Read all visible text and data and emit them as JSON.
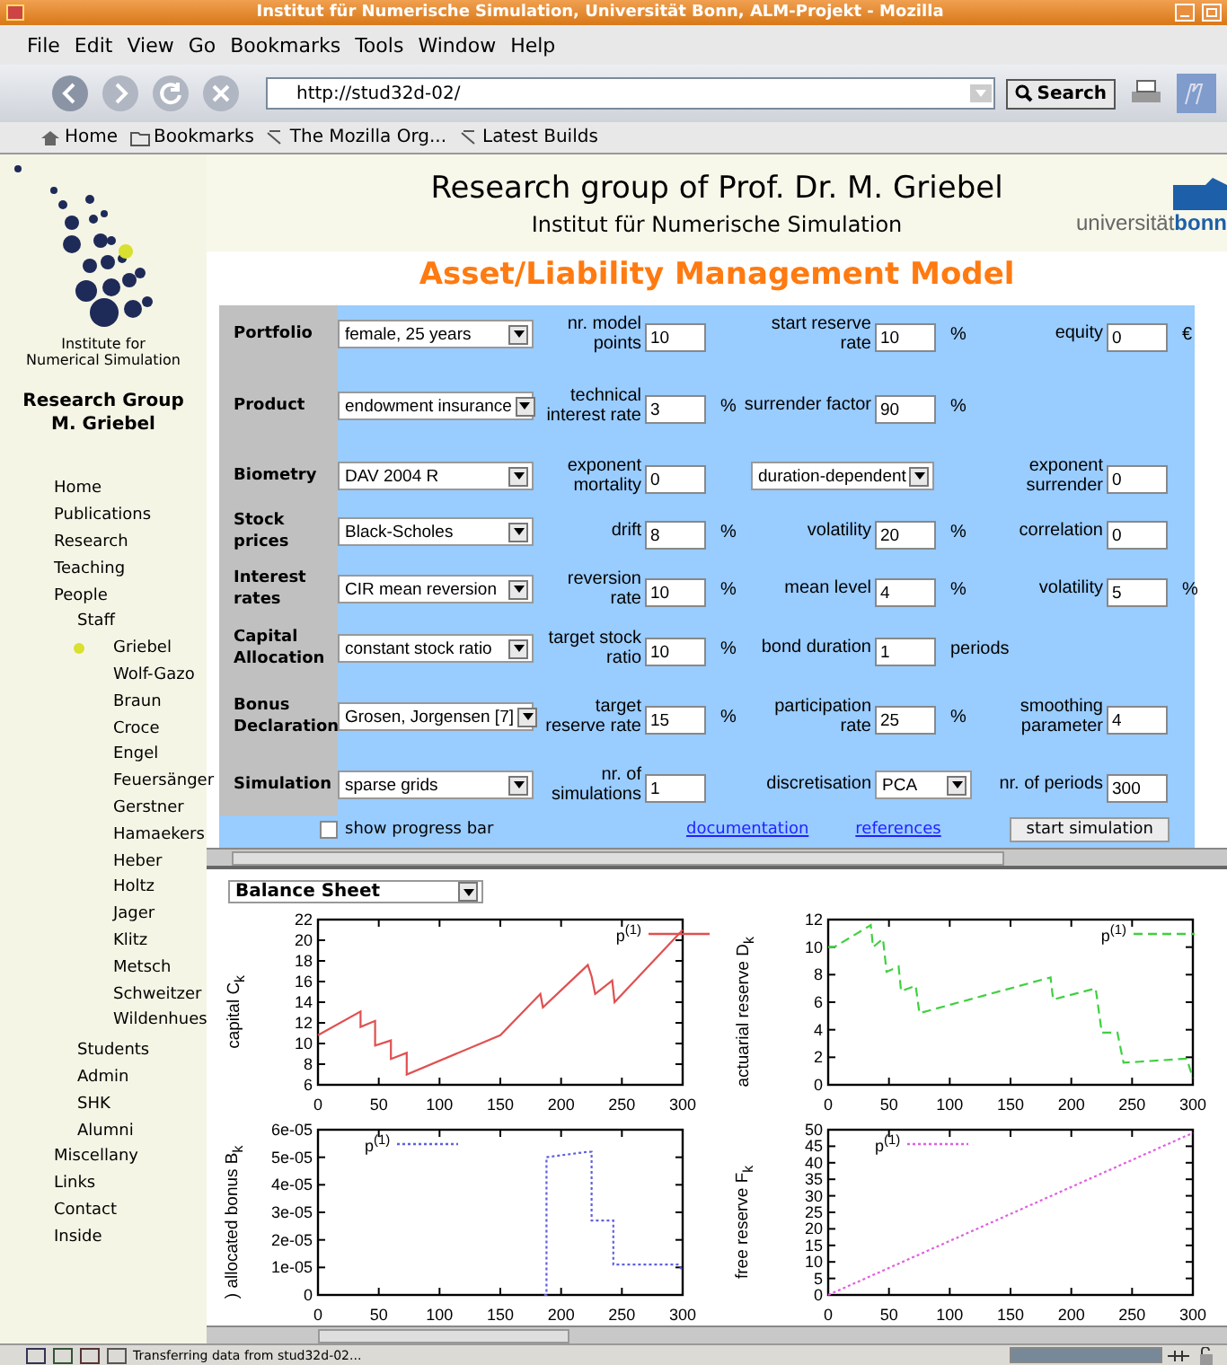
{
  "window": {
    "title": "Institut für Numerische Simulation, Universität Bonn, ALM-Projekt - Mozilla"
  },
  "menu": [
    "File",
    "Edit",
    "View",
    "Go",
    "Bookmarks",
    "Tools",
    "Window",
    "Help"
  ],
  "toolbar": {
    "url": "http://stud32d-02/",
    "search_button": "Search"
  },
  "bookmarks": [
    {
      "label": "Home",
      "kind": "home"
    },
    {
      "label": "Bookmarks",
      "kind": "folder"
    },
    {
      "label": "The Mozilla Org...",
      "kind": "link"
    },
    {
      "label": "Latest Builds",
      "kind": "link"
    }
  ],
  "sidebar": {
    "institute": "Institute for Numerical Simulation",
    "group": "Research Group M. Griebel",
    "items": [
      {
        "label": "Home",
        "selected": false
      },
      {
        "label": "Publications",
        "selected": false
      },
      {
        "label": "Research",
        "selected": false
      },
      {
        "label": "Teaching",
        "selected": false
      },
      {
        "label": "People",
        "selected": false,
        "children": [
          {
            "label": "Staff",
            "selected": false,
            "children": [
              {
                "label": "Griebel",
                "selected": true
              },
              {
                "label": "Wolf-Gazo",
                "selected": false
              },
              {
                "label": "Braun",
                "selected": false
              },
              {
                "label": "Croce",
                "selected": false
              },
              {
                "label": "Engel",
                "selected": false
              },
              {
                "label": "Feuersänger",
                "selected": false
              },
              {
                "label": "Gerstner",
                "selected": false
              },
              {
                "label": "Hamaekers",
                "selected": false
              },
              {
                "label": "Heber",
                "selected": false
              },
              {
                "label": "Holtz",
                "selected": false
              },
              {
                "label": "Jager",
                "selected": false
              },
              {
                "label": "Klitz",
                "selected": false
              },
              {
                "label": "Metsch",
                "selected": false
              },
              {
                "label": "Schweitzer",
                "selected": false
              },
              {
                "label": "Wildenhues",
                "selected": false
              }
            ]
          },
          {
            "label": "Students",
            "selected": false
          },
          {
            "label": "Admin",
            "selected": false
          },
          {
            "label": "SHK",
            "selected": false
          },
          {
            "label": "Alumni",
            "selected": false
          }
        ]
      },
      {
        "label": "Miscellany",
        "selected": false
      },
      {
        "label": "Links",
        "selected": false
      },
      {
        "label": "Contact",
        "selected": false
      },
      {
        "label": "Inside",
        "selected": false
      }
    ]
  },
  "header": {
    "title": "Research group of Prof. Dr. M. Griebel",
    "subtitle": "Institut für Numerische Simulation",
    "logo_prefix": "universität",
    "logo_name": "bonn"
  },
  "page_title": "Asset/Liability Management Model",
  "form": {
    "rows": [
      {
        "label": "Portfolio",
        "select": "female, 25 years",
        "fields": [
          {
            "kind": "input",
            "label": "nr. model points",
            "value": "10"
          },
          {
            "kind": "input",
            "label": "start reserve rate",
            "value": "10",
            "unit": "%"
          },
          {
            "kind": "input",
            "label": "equity",
            "value": "0",
            "unit": "€"
          }
        ]
      },
      {
        "label": "Product",
        "select": "endowment insurance",
        "fields": [
          {
            "kind": "input",
            "label": "technical interest rate",
            "value": "3",
            "unit": "%"
          },
          {
            "kind": "input",
            "label": "surrender factor",
            "value": "90",
            "unit": "%"
          }
        ]
      },
      {
        "label": "Biometry",
        "select": "DAV 2004 R",
        "fields": [
          {
            "kind": "input",
            "label": "exponent mortality",
            "value": "0"
          },
          {
            "kind": "select",
            "value": "duration-dependent"
          },
          {
            "kind": "input",
            "label": "exponent surrender",
            "value": "0"
          }
        ]
      },
      {
        "label": "Stock prices",
        "select": "Black-Scholes",
        "fields": [
          {
            "kind": "input",
            "label": "drift",
            "value": "8",
            "unit": "%"
          },
          {
            "kind": "input",
            "label": "volatility",
            "value": "20",
            "unit": "%"
          },
          {
            "kind": "input",
            "label": "correlation",
            "value": "0"
          }
        ]
      },
      {
        "label": "Interest rates",
        "select": "CIR mean reversion",
        "fields": [
          {
            "kind": "input",
            "label": "reversion rate",
            "value": "10",
            "unit": "%"
          },
          {
            "kind": "input",
            "label": "mean level",
            "value": "4",
            "unit": "%"
          },
          {
            "kind": "input",
            "label": "volatility",
            "value": "5",
            "unit": "%"
          }
        ]
      },
      {
        "label": "Capital Allocation",
        "select": "constant stock ratio",
        "fields": [
          {
            "kind": "input",
            "label": "target stock ratio",
            "value": "10",
            "unit": "%"
          },
          {
            "kind": "input",
            "label": "bond duration",
            "value": "1",
            "unit": "periods"
          }
        ]
      },
      {
        "label": "Bonus Declaration",
        "select": "Grosen, Jorgensen [7]",
        "fields": [
          {
            "kind": "input",
            "label": "target reserve rate",
            "value": "15",
            "unit": "%"
          },
          {
            "kind": "input",
            "label": "participation rate",
            "value": "25",
            "unit": "%"
          },
          {
            "kind": "input",
            "label": "smoothing parameter",
            "value": "4"
          }
        ]
      },
      {
        "label": "Simulation",
        "select": "sparse grids",
        "fields": [
          {
            "kind": "input",
            "label": "nr. of simulations",
            "value": "1"
          },
          {
            "kind": "select",
            "label": "discretisation",
            "value": "PCA"
          },
          {
            "kind": "input",
            "label": "nr. of periods",
            "value": "300"
          }
        ]
      }
    ],
    "progress": {
      "label": "show progress bar",
      "checked": false
    },
    "links": [
      "documentation",
      "references"
    ],
    "start_button": "start simulation"
  },
  "applet": {
    "view": "Balance Sheet",
    "charts": [
      {
        "chart_data": {
          "type": "line",
          "ylabel": "capital C$_{k}$",
          "xlim": [
            0,
            300
          ],
          "ylim": [
            6,
            22
          ],
          "xticks": [
            0,
            50,
            100,
            150,
            200,
            250,
            300
          ],
          "yticks": [
            6,
            8,
            10,
            12,
            14,
            16,
            18,
            20,
            22
          ],
          "x": [
            0,
            35,
            35,
            47,
            47,
            60,
            60,
            73,
            73,
            150,
            183,
            185,
            222,
            225,
            228,
            242,
            244,
            300
          ],
          "series": [
            {
              "name": "p$^{(1)}$",
              "color": "#e05050",
              "line_style": "solid",
              "values": [
                10.8,
                13.1,
                11.6,
                12.2,
                9.8,
                10.3,
                8.5,
                9.1,
                7.0,
                10.8,
                14.8,
                13.5,
                17.6,
                16.5,
                14.8,
                16.1,
                14.0,
                21
              ]
            }
          ]
        }
      },
      {
        "chart_data": {
          "type": "line",
          "ylabel": "actuarial reserve D$_{k}$",
          "xlim": [
            0,
            300
          ],
          "ylim": [
            0,
            12
          ],
          "xticks": [
            0,
            50,
            100,
            150,
            200,
            250,
            300
          ],
          "yticks": [
            0,
            2,
            4,
            6,
            8,
            10,
            12
          ],
          "x": [
            0,
            5,
            35,
            37,
            45,
            48,
            58,
            60,
            72,
            75,
            183,
            185,
            220,
            225,
            238,
            243,
            295,
            300
          ],
          "series": [
            {
              "name": "p$^{(1)}$",
              "color": "#40d040",
              "line_style": "dashed",
              "values": [
                10,
                10,
                11.6,
                10,
                10.6,
                8.2,
                8.6,
                6.8,
                7.2,
                5.2,
                7.8,
                6.2,
                7.0,
                3.8,
                3.8,
                1.6,
                1.9,
                0.5
              ]
            }
          ]
        }
      },
      {
        "chart_data": {
          "type": "line",
          "ylabel": ") allocated bonus B$_{k}$",
          "xlim": [
            0,
            300
          ],
          "ylim": [
            0,
            6e-05
          ],
          "xticks": [
            0,
            50,
            100,
            150,
            200,
            250,
            300
          ],
          "yticks": [
            {
              "value": 0,
              "label": "0"
            },
            {
              "value": 1e-05,
              "label": "1e-05"
            },
            {
              "value": 2e-05,
              "label": "2e-05"
            },
            {
              "value": 3e-05,
              "label": "3e-05"
            },
            {
              "value": 4e-05,
              "label": "4e-05"
            },
            {
              "value": 5e-05,
              "label": "5e-05"
            },
            {
              "value": 6e-05,
              "label": "6e-05"
            }
          ],
          "x": [
            186,
            188,
            188,
            222,
            225,
            225,
            241,
            243,
            243,
            296,
            300
          ],
          "series": [
            {
              "name": "p$^{(1)}$",
              "color": "#6060e0",
              "line_style": "dotted",
              "values": [
                0,
                0,
                5e-05,
                5.2e-05,
                5.2e-05,
                2.7e-05,
                2.7e-05,
                2.7e-05,
                1.1e-05,
                1.1e-05,
                9e-06
              ]
            }
          ]
        }
      },
      {
        "chart_data": {
          "type": "line",
          "ylabel": "free reserve F$_{k}$",
          "xlim": [
            0,
            300
          ],
          "ylim": [
            0,
            50
          ],
          "xticks": [
            0,
            50,
            100,
            150,
            200,
            250,
            300
          ],
          "yticks": [
            0,
            5,
            10,
            15,
            20,
            25,
            30,
            35,
            40,
            45,
            50
          ],
          "x": [
            0,
            300
          ],
          "series": [
            {
              "name": "p$^{(1)}$",
              "color": "#e060e0",
              "line_style": "dotted",
              "values": [
                0,
                49
              ]
            }
          ]
        }
      }
    ]
  },
  "status_bar": {
    "text": "Transferring data from stud32d-02...",
    "level": 1
  }
}
